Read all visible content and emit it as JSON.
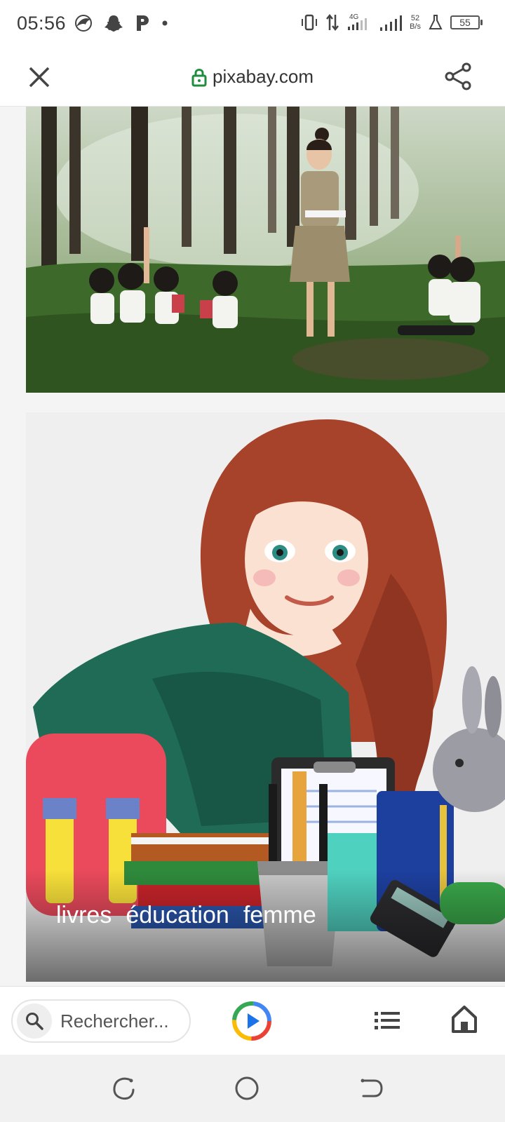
{
  "status_bar": {
    "time": "05:56",
    "network_type": "4G",
    "net_speed_value": "52",
    "net_speed_unit": "B/s",
    "battery_level": "55"
  },
  "browser": {
    "url": "pixabay.com"
  },
  "results": {
    "caption_tags": [
      "livres",
      "éducation",
      "femme"
    ]
  },
  "toolbar": {
    "search_placeholder": "Rechercher..."
  },
  "colors": {
    "secure_lock": "#1e8e3e",
    "forest_dark": "#2f4a24",
    "sweater_green": "#1f6b55",
    "hair_red": "#a8432b"
  }
}
